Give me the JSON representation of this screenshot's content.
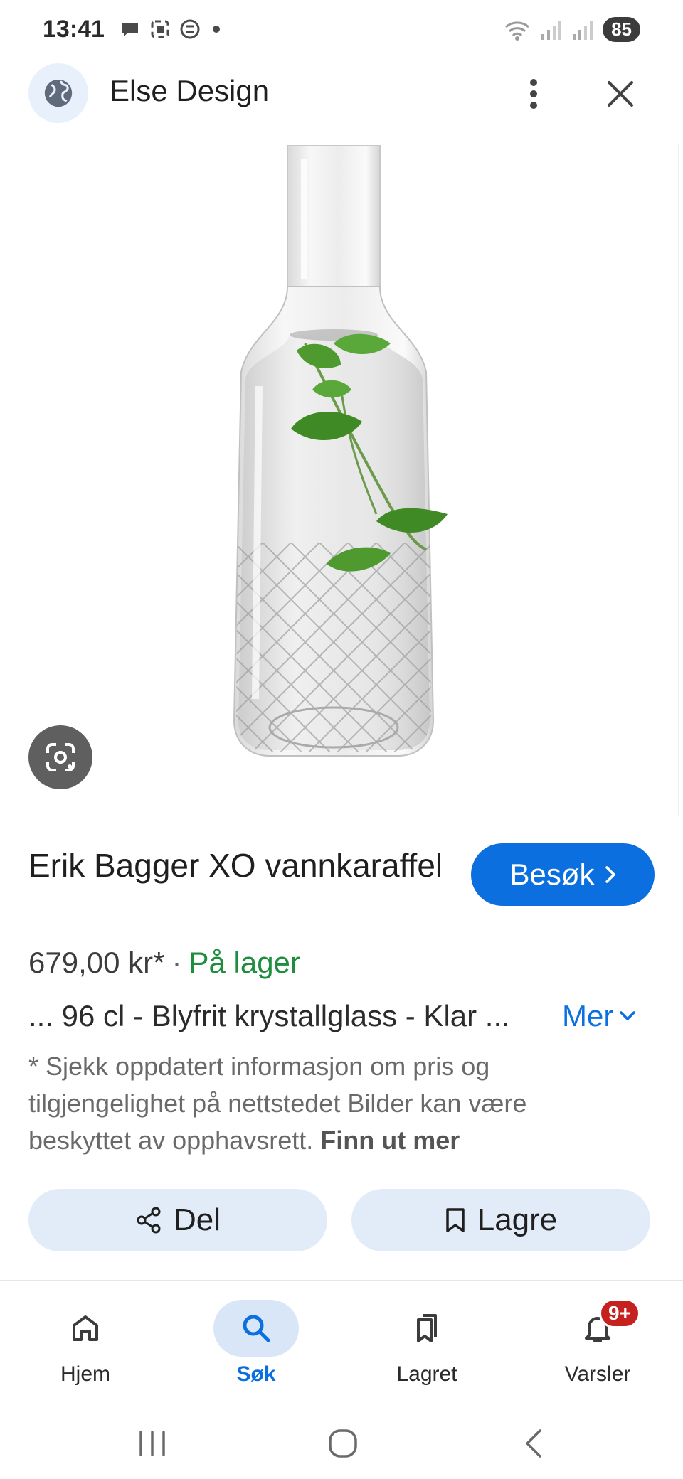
{
  "status_bar": {
    "time": "13:41",
    "battery": "85"
  },
  "header": {
    "site_name": "Else Design"
  },
  "product": {
    "title": "Erik Bagger XO vannkaraffel",
    "visit_label": "Besøk",
    "price": "679,00 kr*",
    "separator": "·",
    "stock": "På lager",
    "description": "... 96 cl - Blyfrit krystallglass - Klar ...",
    "more_label": "Mer",
    "disclaimer": "* Sjekk oppdatert informasjon om pris og tilgjengelighet på nettstedet Bilder kan være beskyttet av opphavsrett.",
    "learn_more": "Finn ut mer"
  },
  "actions": {
    "share_label": "Del",
    "save_label": "Lagre"
  },
  "bottom_nav": {
    "items": [
      {
        "label": "Hjem",
        "icon": "home-icon"
      },
      {
        "label": "Søk",
        "icon": "search-icon",
        "active": true
      },
      {
        "label": "Lagret",
        "icon": "saved-icon"
      },
      {
        "label": "Varsler",
        "icon": "bell-icon",
        "badge": "9+"
      }
    ]
  },
  "colors": {
    "accent": "#0b6fe0",
    "stock_green": "#1e8e3e",
    "badge_red": "#c5221f",
    "pill_bg": "#e2ecf8"
  }
}
